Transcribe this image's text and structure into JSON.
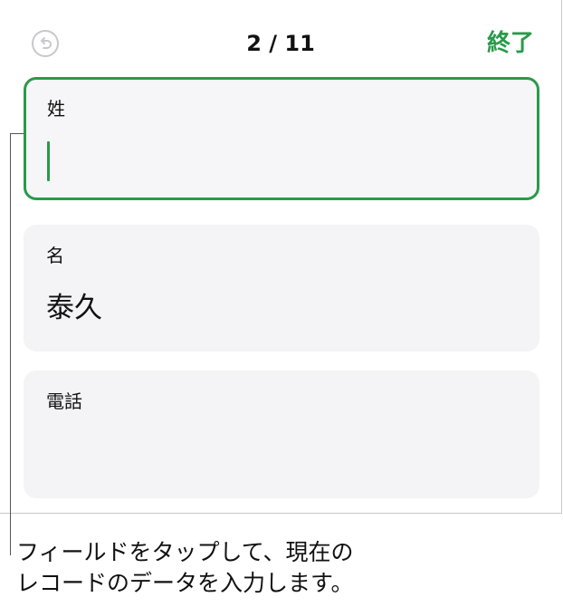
{
  "header": {
    "undo_icon": "undo-arrow-icon",
    "record_counter": "2 / 11",
    "done_label": "終了"
  },
  "fields": [
    {
      "label": "姓",
      "value": "",
      "active": true
    },
    {
      "label": "名",
      "value": "泰久",
      "active": false
    },
    {
      "label": "電話",
      "value": "",
      "active": false
    }
  ],
  "callout": {
    "line1": "フィールドをタップして、現在の",
    "line2": "レコードのデータを入力します。"
  },
  "colors": {
    "accent": "#2a9a4a",
    "field_background": "#f4f4f6",
    "disabled_icon": "#c8c8cc"
  }
}
